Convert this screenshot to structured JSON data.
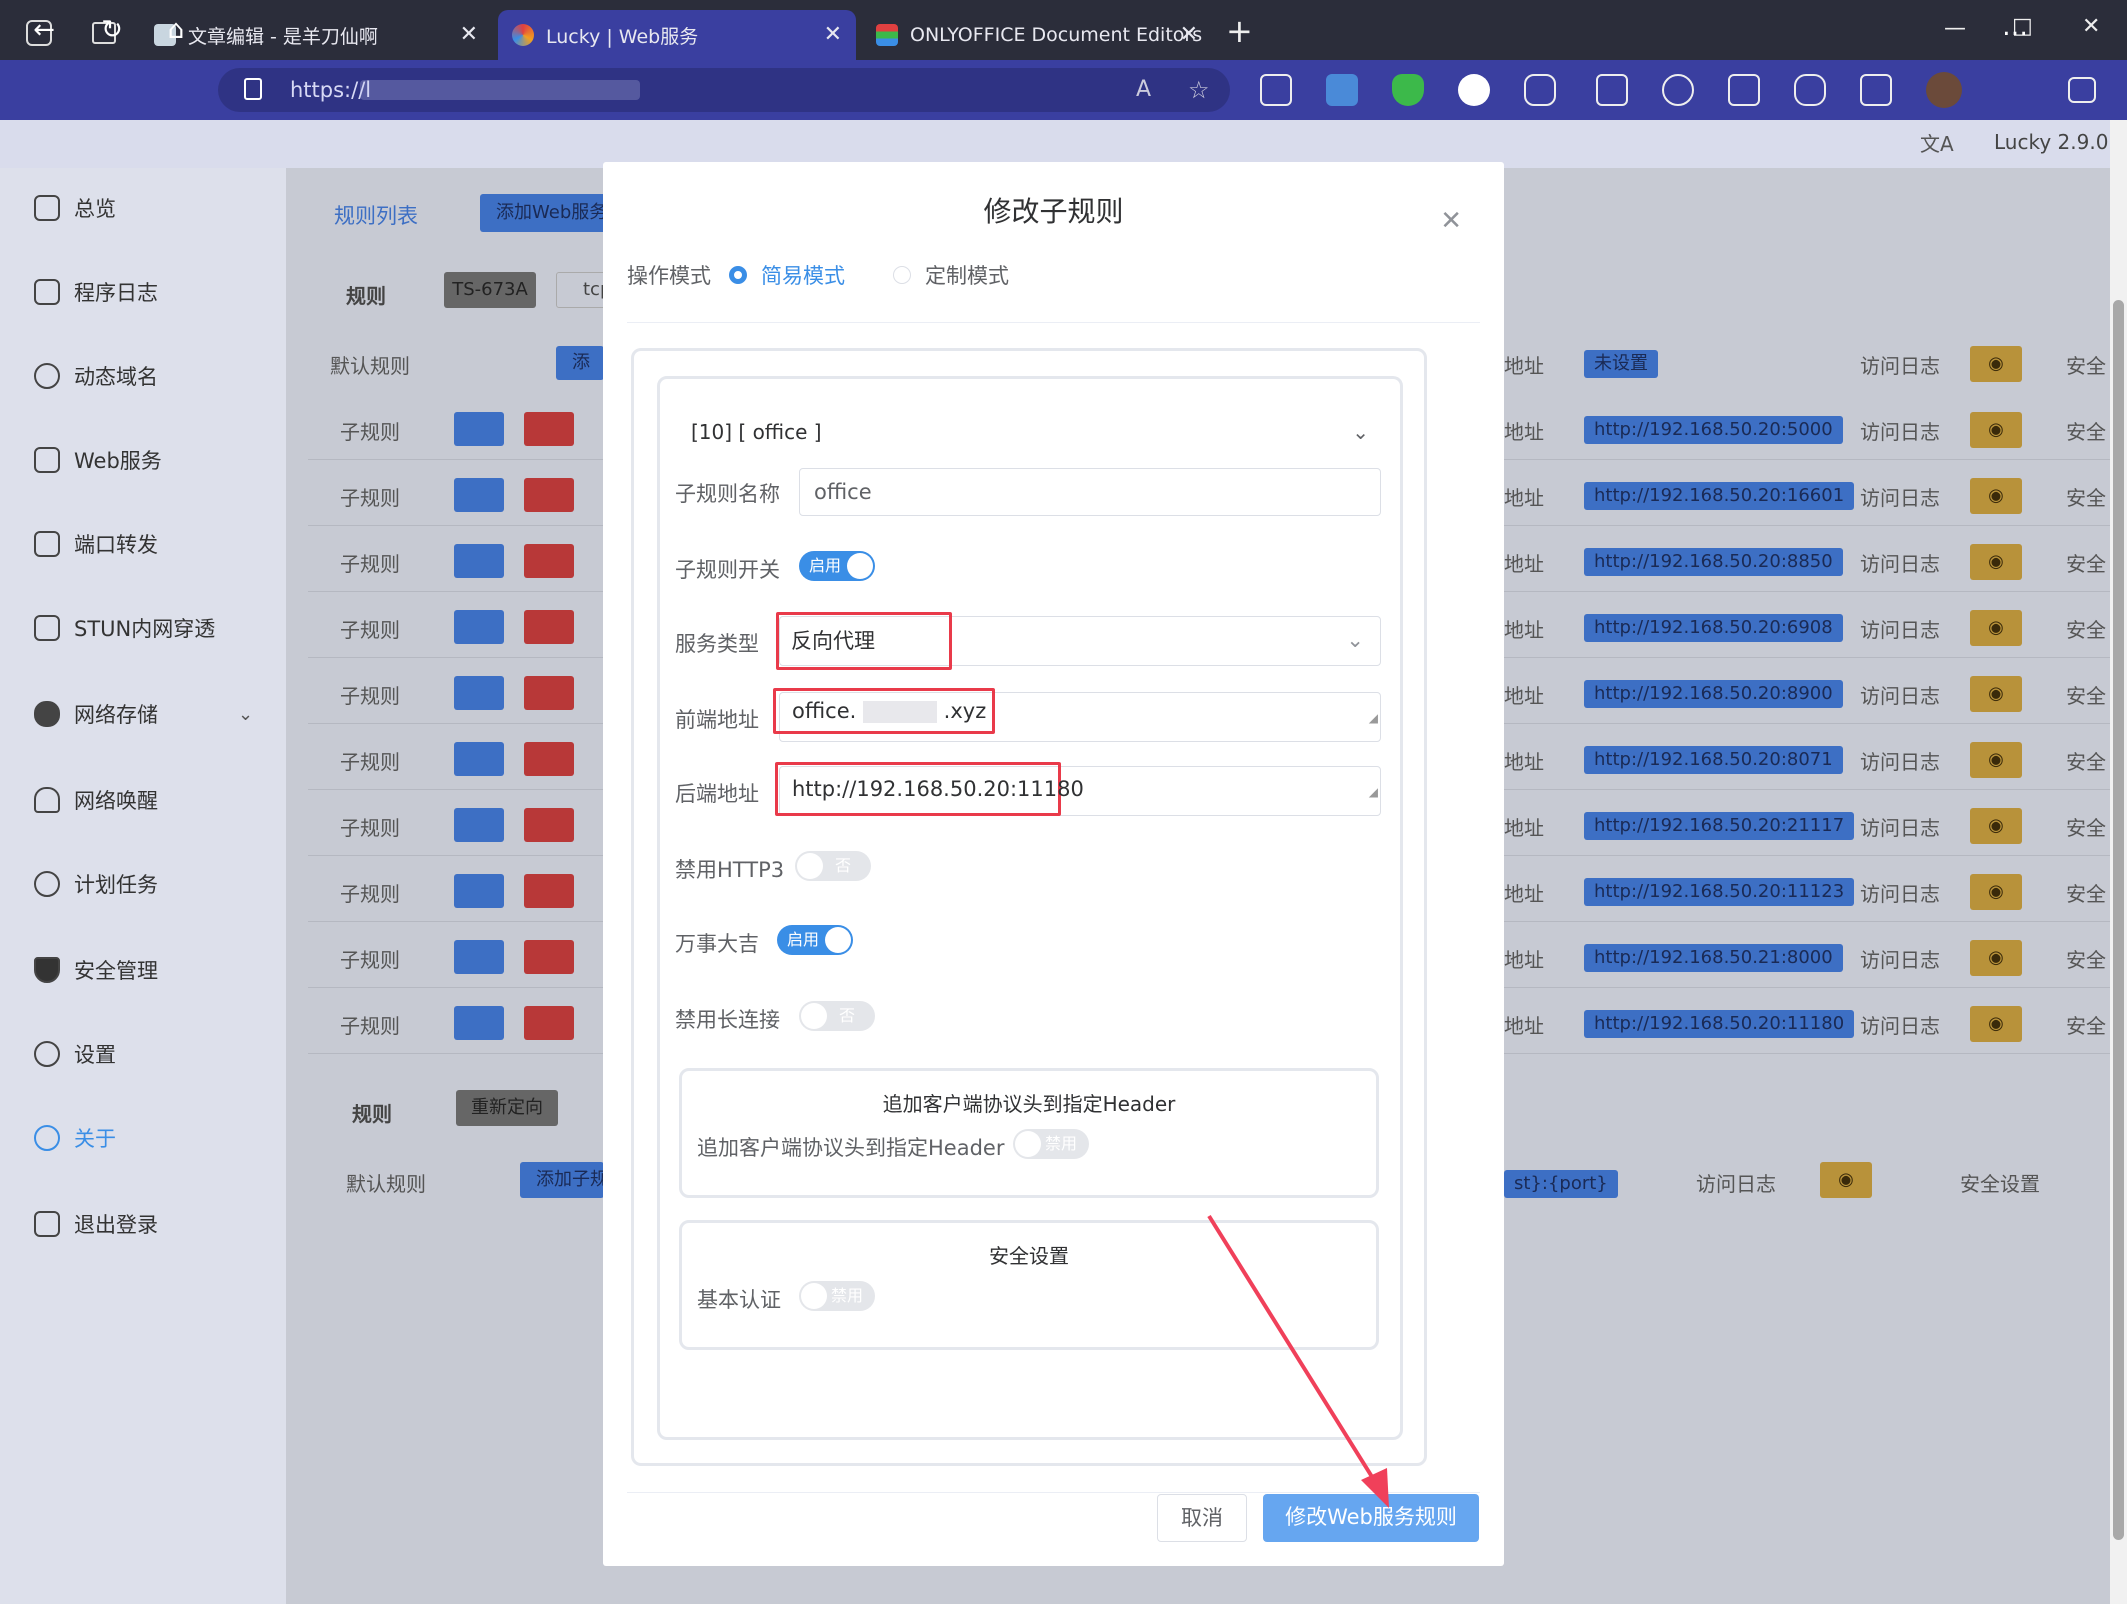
{
  "browser": {
    "tabs": [
      {
        "title": "文章编辑 - 是羊刀仙啊"
      },
      {
        "title": "Lucky | Web服务"
      },
      {
        "title": "ONLYOFFICE Document Editors"
      }
    ],
    "url": "https://l",
    "new_tab": "+",
    "window_controls": [
      "—",
      "□",
      "✕"
    ]
  },
  "app": {
    "version": "Lucky 2.9.0",
    "translate": "文A"
  },
  "sidebar": {
    "items": [
      {
        "label": "总览",
        "icon": "dashboard-icon"
      },
      {
        "label": "程序日志",
        "icon": "log-icon"
      },
      {
        "label": "动态域名",
        "icon": "dns-icon"
      },
      {
        "label": "Web服务",
        "icon": "web-icon"
      },
      {
        "label": "端口转发",
        "icon": "port-forward-icon"
      },
      {
        "label": "STUN内网穿透",
        "icon": "stun-icon"
      },
      {
        "label": "网络存储",
        "icon": "cloud-icon"
      },
      {
        "label": "网络唤醒",
        "icon": "bell-icon"
      },
      {
        "label": "计划任务",
        "icon": "clock-icon"
      },
      {
        "label": "安全管理",
        "icon": "shield-icon"
      },
      {
        "label": "设置",
        "icon": "gear-icon"
      },
      {
        "label": "关于",
        "icon": "about-icon"
      },
      {
        "label": "退出登录",
        "icon": "logout-icon"
      }
    ]
  },
  "background": {
    "tab_list": "规则列表",
    "tab_add": "添加Web服务",
    "rule_label": "规则",
    "rule_tag": "TS-673A",
    "rule_proto": "tcp",
    "default_rule": "默认规则",
    "add_short": "添加",
    "sub_rule": "子规则",
    "addr": "地址",
    "not_set": "未设置",
    "access_log": "访问日志",
    "security": "安全",
    "backends": [
      "http://192.168.50.20:5000",
      "http://192.168.50.20:16601",
      "http://192.168.50.20:8850",
      "http://192.168.50.20:6908",
      "http://192.168.50.20:8900",
      "http://192.168.50.20:8071",
      "http://192.168.50.20:21117",
      "http://192.168.50.20:11123",
      "http://192.168.50.21:8000",
      "http://192.168.50.20:11180"
    ],
    "rule2_label": "规则",
    "rule2_tag": "重新定向",
    "rule2_default": "默认规则",
    "rule2_add": "添加子规",
    "rule2_target": "st}:{port}",
    "rule2_log": "访问日志",
    "rule2_security": "安全设置"
  },
  "modal": {
    "title": "修改子规则",
    "mode_label": "操作模式",
    "mode_simple": "简易模式",
    "mode_custom": "定制模式",
    "subrule_select": "[10] [ office ]",
    "name_label": "子规则名称",
    "name_value": "office",
    "switch_label": "子规则开关",
    "switch_on": "启用",
    "service_type_label": "服务类型",
    "service_type_value": "反向代理",
    "frontend_label": "前端地址",
    "frontend_value_a": "office.",
    "frontend_value_b": ".xyz",
    "backend_label": "后端地址",
    "backend_value": "http://192.168.50.20:11180",
    "http3_label": "禁用HTTP3",
    "http3_value": "否",
    "lucky_label": "万事大吉",
    "lucky_value": "启用",
    "keepalive_label": "禁用长连接",
    "keepalive_value": "否",
    "header_box_title": "追加客户端协议头到指定Header",
    "header_label": "追加客户端协议头到指定Header",
    "header_value": "禁用",
    "security_box_title": "安全设置",
    "basic_auth_label": "基本认证",
    "basic_auth_value": "禁用",
    "cancel": "取消",
    "submit": "修改Web服务规则"
  }
}
